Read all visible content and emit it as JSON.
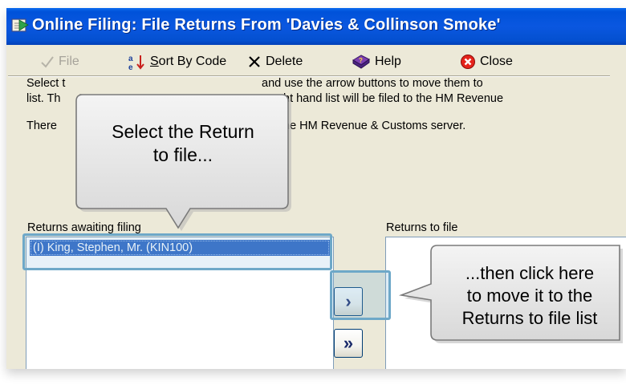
{
  "window": {
    "title": "Online Filing: File Returns From 'Davies & Collinson Smoke'"
  },
  "toolbar": {
    "file_label": "File",
    "sort_label": "Sort By Code",
    "delete_label": "Delete",
    "help_label": "Help",
    "close_label": "Close"
  },
  "instructions": {
    "line1_left": "Select t",
    "line1_right": "and use the arrow buttons to move them to",
    "line2_left": "list.  Th",
    "line2_right": "ht hand list will be filed to the HM Revenue",
    "line3_left": "There",
    "line3_right": "he HM Revenue & Customs server."
  },
  "awaiting": {
    "label": "Returns awaiting filing",
    "items": [
      "(I) King, Stephen, Mr. (KIN100)"
    ]
  },
  "to_file": {
    "label": "Returns to file"
  },
  "buttons": {
    "move_one": "›",
    "move_all": "»"
  },
  "callouts": {
    "select": [
      "Select the Return",
      "to file..."
    ],
    "click": [
      "...then click here",
      "to move it to the",
      "Returns to file list"
    ]
  },
  "colors": {
    "titlebar": "#0a57e0",
    "selection": "#316ac5",
    "window_bg": "#ece9d8",
    "highlight": "#6ea8c8"
  }
}
